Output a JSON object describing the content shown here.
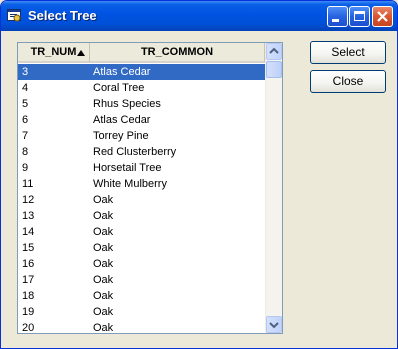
{
  "window": {
    "title": "Select Tree"
  },
  "icons": {
    "app": "tree-app-icon",
    "minimize": "minimize-icon",
    "maximize": "maximize-icon",
    "close": "close-icon",
    "scroll_up": "scroll-up-arrow-icon",
    "scroll_down": "scroll-down-arrow-icon",
    "sort": "sort-ascending-icon"
  },
  "list": {
    "columns": [
      "TR_NUM",
      "TR_COMMON"
    ],
    "rows": [
      {
        "num": "3",
        "common": "Atlas Cedar",
        "selected": true
      },
      {
        "num": "4",
        "common": "Coral Tree"
      },
      {
        "num": "5",
        "common": "Rhus Species"
      },
      {
        "num": "6",
        "common": "Atlas Cedar"
      },
      {
        "num": "7",
        "common": "Torrey Pine"
      },
      {
        "num": "8",
        "common": "Red Clusterberry"
      },
      {
        "num": "9",
        "common": "Horsetail Tree"
      },
      {
        "num": "11",
        "common": "White Mulberry"
      },
      {
        "num": "12",
        "common": "Oak"
      },
      {
        "num": "13",
        "common": "Oak"
      },
      {
        "num": "14",
        "common": "Oak"
      },
      {
        "num": "15",
        "common": "Oak"
      },
      {
        "num": "16",
        "common": "Oak"
      },
      {
        "num": "17",
        "common": "Oak"
      },
      {
        "num": "18",
        "common": "Oak"
      },
      {
        "num": "19",
        "common": "Oak"
      },
      {
        "num": "20",
        "common": "Oak"
      }
    ]
  },
  "buttons": {
    "select": "Select",
    "close": "Close"
  },
  "colors": {
    "titlebar": "#0054e3",
    "selection": "#316ac5",
    "face": "#ece9d8"
  }
}
